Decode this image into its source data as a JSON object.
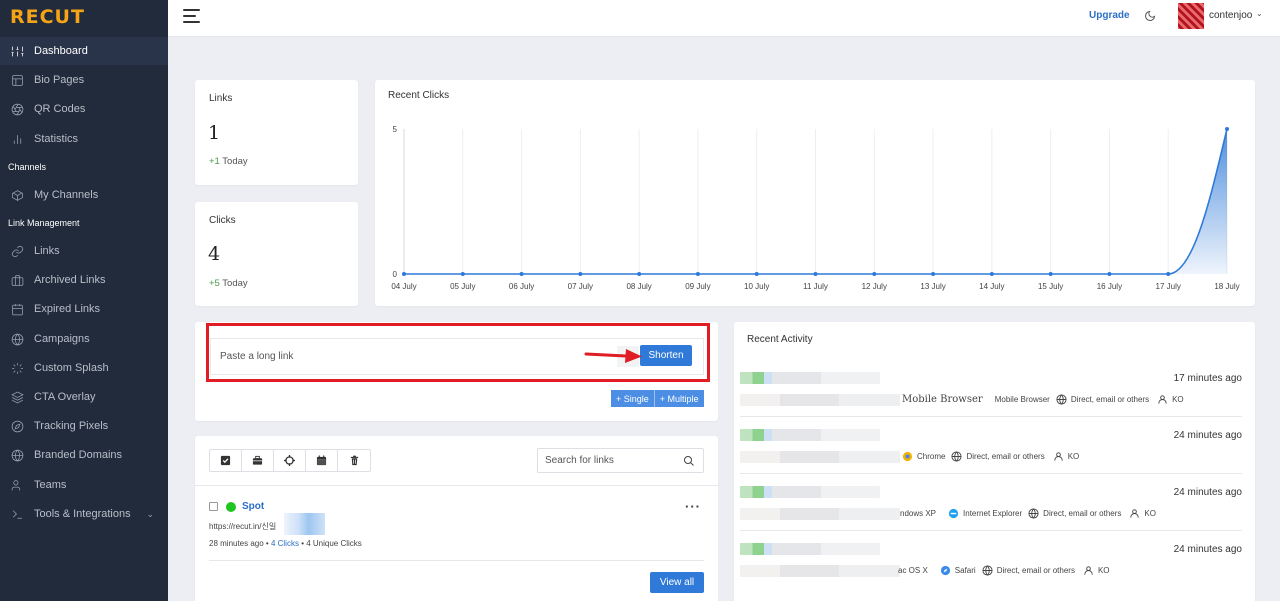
{
  "app": {
    "logo": "RECUT"
  },
  "sidebar": {
    "sections": [
      {
        "heading": "",
        "items": [
          {
            "label": "Dashboard",
            "icon": "sliders-icon",
            "active": true
          },
          {
            "label": "Bio Pages",
            "icon": "layout-icon"
          },
          {
            "label": "QR Codes",
            "icon": "aperture-icon"
          },
          {
            "label": "Statistics",
            "icon": "bar-chart-icon"
          }
        ]
      },
      {
        "heading": "Channels",
        "items": [
          {
            "label": "My Channels",
            "icon": "box-icon"
          }
        ]
      },
      {
        "heading": "Link Management",
        "items": [
          {
            "label": "Links",
            "icon": "link-icon"
          },
          {
            "label": "Archived Links",
            "icon": "briefcase-icon"
          },
          {
            "label": "Expired Links",
            "icon": "calendar-icon"
          },
          {
            "label": "Campaigns",
            "icon": "globe-icon"
          },
          {
            "label": "Custom Splash",
            "icon": "loader-icon"
          },
          {
            "label": "CTA Overlay",
            "icon": "layers-icon"
          },
          {
            "label": "Tracking Pixels",
            "icon": "compass-icon"
          },
          {
            "label": "Branded Domains",
            "icon": "globe-icon"
          },
          {
            "label": "Teams",
            "icon": "users-icon"
          },
          {
            "label": "Tools & Integrations",
            "icon": "terminal-icon",
            "expandable": true
          }
        ]
      }
    ]
  },
  "topbar": {
    "upgrade": "Upgrade",
    "username": "contenjoo"
  },
  "stats": {
    "links": {
      "label": "Links",
      "value": "1",
      "delta": "+1",
      "delta_suffix": " Today"
    },
    "clicks": {
      "label": "Clicks",
      "value": "4",
      "delta": "+5",
      "delta_suffix": " Today"
    }
  },
  "recent_clicks": {
    "title": "Recent Clicks"
  },
  "chart_data": {
    "type": "area",
    "title": "Recent Clicks",
    "categories": [
      "04 July",
      "05 July",
      "06 July",
      "07 July",
      "08 July",
      "09 July",
      "10 July",
      "11 July",
      "12 July",
      "13 July",
      "14 July",
      "15 July",
      "16 July",
      "17 July",
      "18 July"
    ],
    "series": [
      {
        "values": [
          0,
          0,
          0,
          0,
          0,
          0,
          0,
          0,
          0,
          0,
          0,
          0,
          0,
          0,
          5
        ]
      }
    ],
    "yticks": [
      0,
      5
    ],
    "ylim": [
      0,
      5
    ],
    "grid": "vertical",
    "colors": {
      "line": "#2f7ad8",
      "fill": "#2f7ad8"
    }
  },
  "shorten": {
    "placeholder": "Paste a long link",
    "button": "Shorten",
    "single": "+ Single",
    "multiple": "+ Multiple"
  },
  "links_list": {
    "search_placeholder": "Search for links",
    "tool_icons": [
      "check-square-icon",
      "briefcase-icon",
      "crosshair-icon",
      "calendar-icon",
      "trash-icon"
    ],
    "items": [
      {
        "title": "Spot",
        "url": "https://recut.in/신일",
        "time": "28 minutes ago",
        "sep": " • ",
        "clicks": "4 Clicks",
        "unique": " • 4 Unique Clicks"
      }
    ],
    "view_all": "View all"
  },
  "recent_activity": {
    "title": "Recent Activity",
    "items": [
      {
        "time": "17 minutes ago",
        "os": "Mobile Browser",
        "browser": "Mobile Browser",
        "referrer": "Direct, email or others",
        "country": "KO"
      },
      {
        "time": "24 minutes ago",
        "os": "",
        "browser": "Chrome",
        "referrer": "Direct, email or others",
        "country": "KO"
      },
      {
        "time": "24 minutes ago",
        "os": "ndows XP",
        "browser": "Internet Explorer",
        "referrer": "Direct, email or others",
        "country": "KO"
      },
      {
        "time": "24 minutes ago",
        "os": "ac OS X",
        "browser": "Safari",
        "referrer": "Direct, email or others",
        "country": "KO"
      }
    ]
  }
}
